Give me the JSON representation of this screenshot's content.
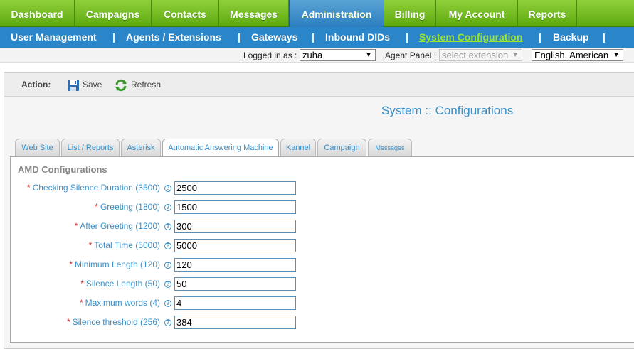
{
  "topnav": {
    "tabs": [
      {
        "label": "Dashboard"
      },
      {
        "label": "Campaigns"
      },
      {
        "label": "Contacts"
      },
      {
        "label": "Messages"
      },
      {
        "label": "Administration"
      },
      {
        "label": "Billing"
      },
      {
        "label": "My Account"
      },
      {
        "label": "Reports"
      }
    ],
    "active_index": 4
  },
  "subnav": {
    "items": [
      {
        "label": "User Management"
      },
      {
        "label": "Agents / Extensions"
      },
      {
        "label": "Gateways"
      },
      {
        "label": "Inbound DIDs"
      },
      {
        "label": "System Configuration"
      },
      {
        "label": "Backup"
      }
    ],
    "separator": "|",
    "active_index": 4
  },
  "loginbar": {
    "logged_in_label": "Logged in as :",
    "user_value": "zuha",
    "agent_panel_label": "Agent Panel :",
    "extension_placeholder": "select extension",
    "language_value": "English, American",
    "arrow": "▼"
  },
  "actionbar": {
    "label": "Action:",
    "save_label": "Save",
    "refresh_label": "Refresh"
  },
  "page_title": "System :: Configurations",
  "config_tabs": [
    {
      "label": "Web Site"
    },
    {
      "label": "List / Reports"
    },
    {
      "label": "Asterisk"
    },
    {
      "label": "Automatic Answering Machine"
    },
    {
      "label": "Kannel"
    },
    {
      "label": "Campaign"
    },
    {
      "label": "Messages"
    }
  ],
  "active_config_tab": 3,
  "section_title": "AMD Configurations",
  "required_mark": "*",
  "help_glyph": "?",
  "fields": [
    {
      "label": "Checking Silence Duration (3500)",
      "value": "2500"
    },
    {
      "label": "Greeting (1800)",
      "value": "1500"
    },
    {
      "label": "After Greeting (1200)",
      "value": "300"
    },
    {
      "label": "Total Time (5000)",
      "value": "5000"
    },
    {
      "label": "Minimum Length (120)",
      "value": "120"
    },
    {
      "label": "Silence Length (50)",
      "value": "50"
    },
    {
      "label": "Maximum words (4)",
      "value": "4"
    },
    {
      "label": "Silence threshold (256)",
      "value": "384"
    }
  ],
  "colors": {
    "topnav_green": "#6fb81f",
    "subnav_blue": "#2a86c8",
    "active_sub_item": "#9be62f",
    "link_blue": "#3a8fc7",
    "required_red": "#d21e1e"
  }
}
